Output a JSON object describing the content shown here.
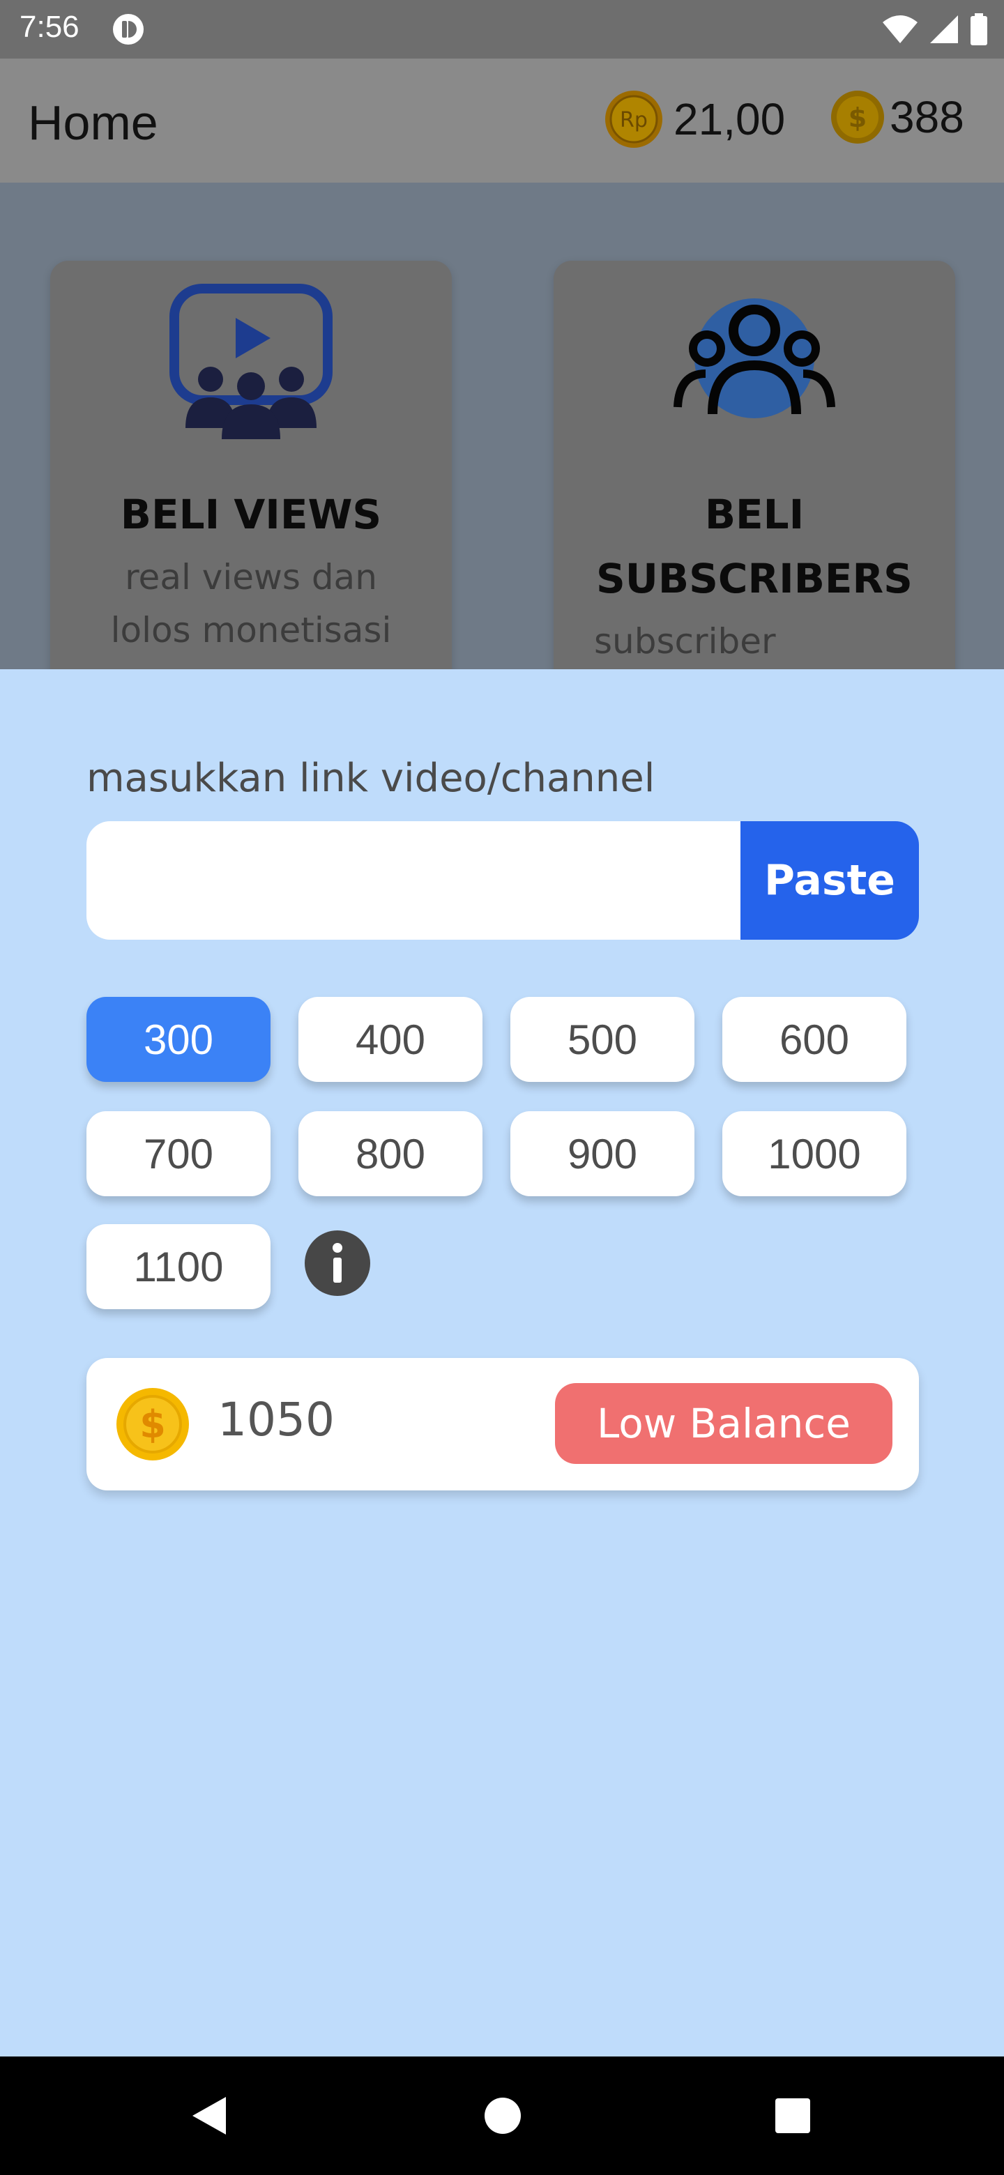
{
  "status_bar": {
    "time": "7:56",
    "icons": [
      "app-notification-icon",
      "wifi-icon",
      "signal-icon",
      "battery-icon"
    ]
  },
  "app_bar": {
    "title": "Home",
    "rp_balance": "21,00",
    "coin_balance": "388",
    "icons": [
      "rp-coin-icon",
      "dollar-coin-icon"
    ]
  },
  "cards": [
    {
      "title_line1": "BELI VIEWS",
      "title_line2": "",
      "desc_line1": "real views dan",
      "desc_line2": "lolos monetisasi",
      "icon": "video-audience-icon"
    },
    {
      "title_line1": "BELI",
      "title_line2": "SUBSCRIBERS",
      "desc_line1": "subscriber",
      "desc_line2": "",
      "icon": "subscribers-group-icon"
    }
  ],
  "sheet": {
    "link_label": "masukkan link video/channel",
    "link_value": "",
    "paste_label": "Paste",
    "amounts": [
      "300",
      "400",
      "500",
      "600",
      "700",
      "800",
      "900",
      "1000",
      "1100"
    ],
    "selected_amount": "300",
    "info_icon": "info-icon",
    "cost": "1050",
    "cost_icon": "dollar-coin-icon",
    "low_balance_label": "Low Balance"
  },
  "nav_bar": {
    "icons": [
      "back-icon",
      "home-icon",
      "recents-icon"
    ]
  },
  "colors": {
    "primary": "#2563eb",
    "selected_chip": "#3b82f6",
    "sheet_background": "#bfdcfb",
    "warning": "#f07070",
    "coin_gold": "#f5b800"
  }
}
